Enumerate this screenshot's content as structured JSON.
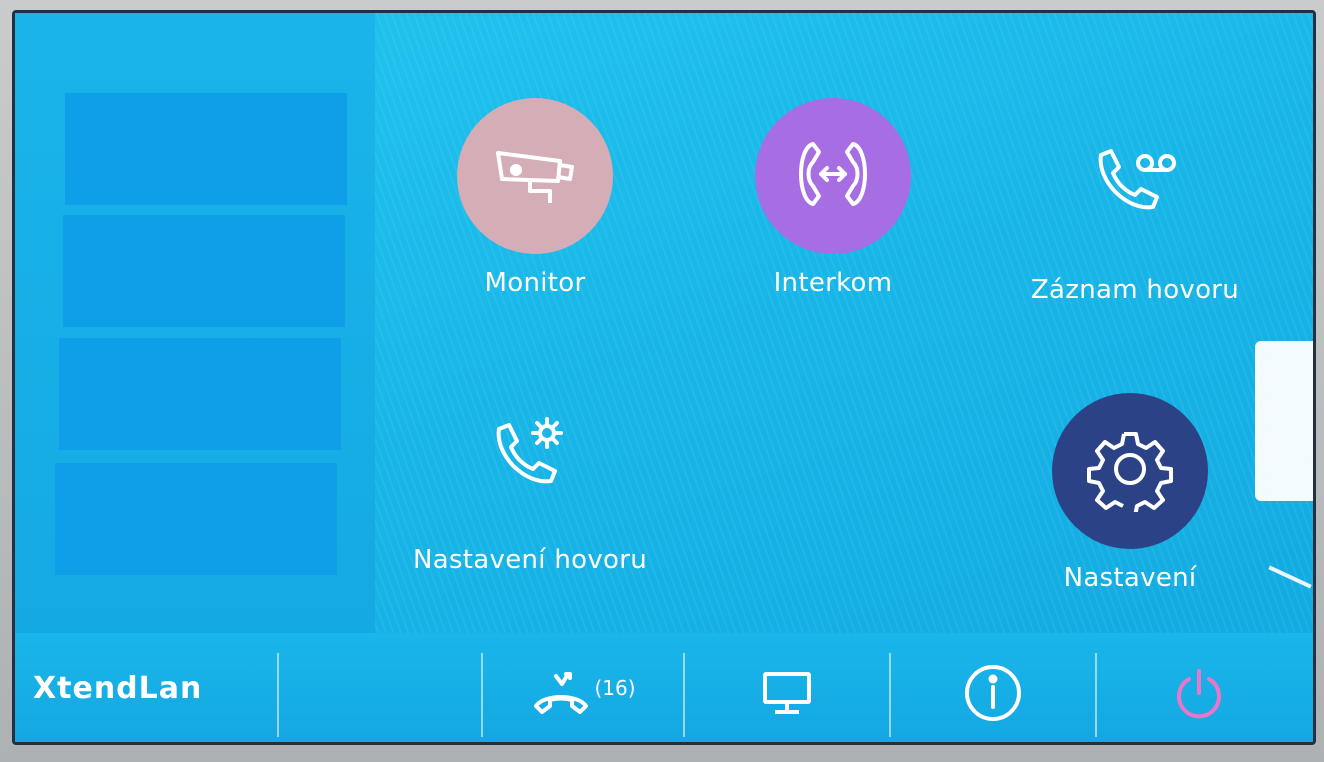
{
  "menu": {
    "monitor": {
      "label": "Monitor",
      "icon": "camera-icon",
      "color": "#d4adb6"
    },
    "interkom": {
      "label": "Interkom",
      "icon": "intercom-icon",
      "color": "#a66ee2"
    },
    "zaznam": {
      "label": "Záznam hovoru",
      "icon": "voicemail-phone-icon"
    },
    "nastaveni_hovoru": {
      "label": "Nastavení hovoru",
      "icon": "phone-settings-icon"
    },
    "nastaveni": {
      "label": "Nastavení",
      "icon": "gear-icon",
      "color": "#2c4286"
    }
  },
  "taskbar": {
    "logo": "XtendLan",
    "missed_calls_count": "(16)",
    "icons": [
      "missed-call-icon",
      "monitor-icon",
      "info-icon",
      "power-icon"
    ],
    "power_color": "#e877c8"
  },
  "colors": {
    "screen": "#18b7e8",
    "slot": "#0f9fe8"
  }
}
